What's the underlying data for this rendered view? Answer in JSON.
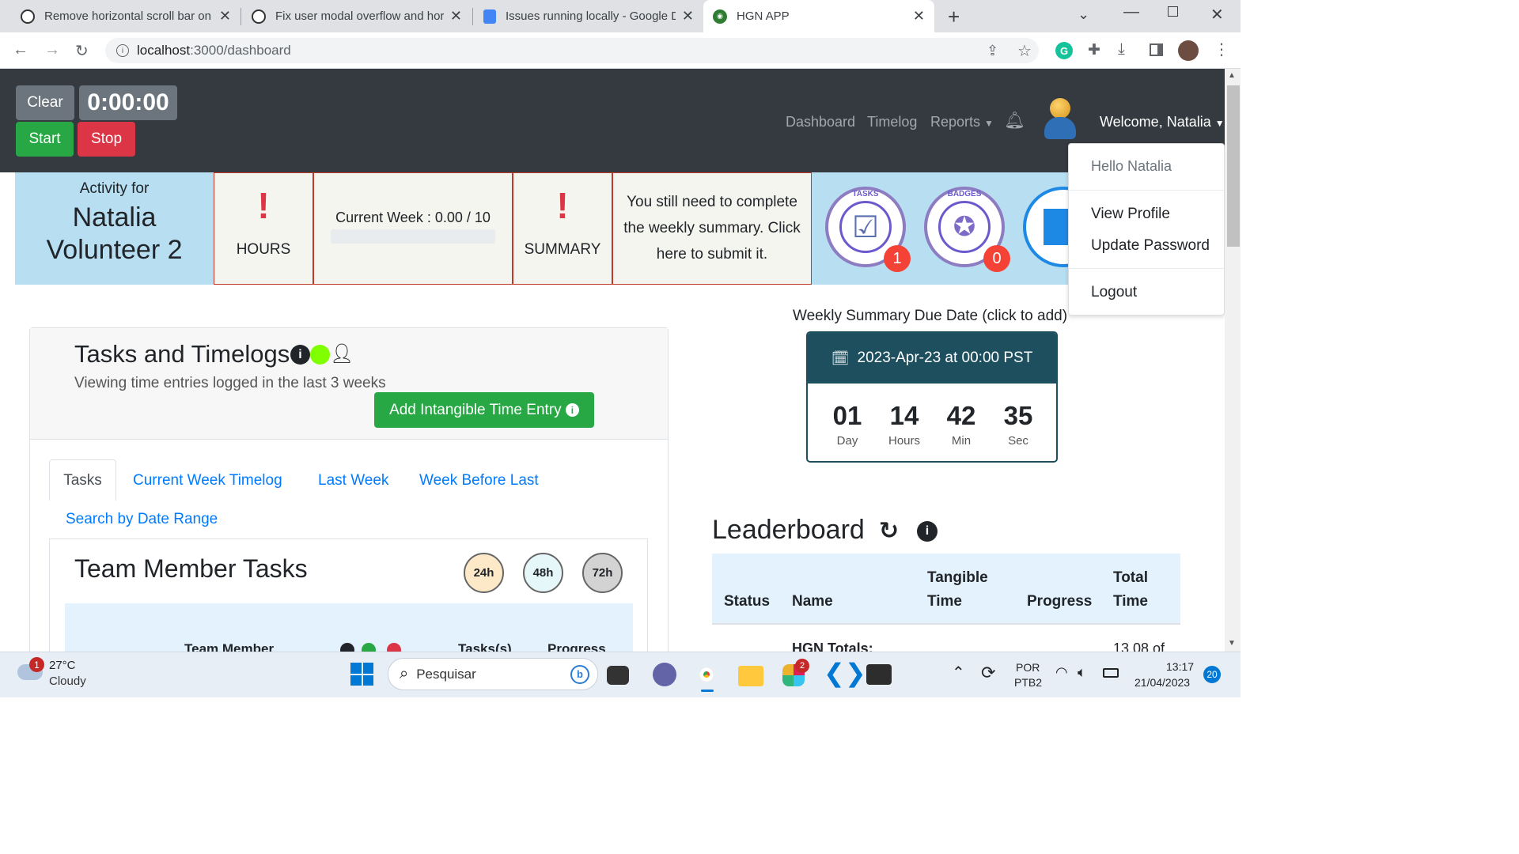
{
  "browser": {
    "tabs": [
      {
        "title": "Remove horizontal scroll bar on c"
      },
      {
        "title": "Fix user modal overflow and hori"
      },
      {
        "title": "Issues running locally - Google D"
      },
      {
        "title": "HGN APP"
      }
    ],
    "new_tab": "+",
    "url_host": "localhost",
    "url_path": ":3000/dashboard"
  },
  "timer": {
    "clear": "Clear",
    "time": "0:00:00",
    "start": "Start",
    "stop": "Stop"
  },
  "nav": {
    "dashboard": "Dashboard",
    "timelog": "Timelog",
    "reports": "Reports",
    "welcome": "Welcome, Natalia"
  },
  "dropdown": {
    "hello": "Hello Natalia",
    "view_profile": "View Profile",
    "update_password": "Update Password",
    "logout": "Logout"
  },
  "activity": {
    "label": "Activity for",
    "name": "Natalia Volunteer 2",
    "hours_label": "HOURS",
    "current_week": "Current Week : 0.00 / 10",
    "week_progress": 0,
    "summary_label": "SUMMARY",
    "summary_msg": "You still need to complete the weekly summary. Click here to submit it.",
    "badge_tasks_count": "1",
    "badge_earned_count": "0",
    "badge_tasks_text": "TASKS",
    "badge_earned_text": "BADGES"
  },
  "tasks_card": {
    "title": "Tasks and Timelogs",
    "subtitle": "Viewing time entries logged in the last 3 weeks",
    "add_button": "Add Intangible Time Entry",
    "tabs": [
      "Tasks",
      "Current Week Timelog",
      "Last Week",
      "Week Before Last"
    ],
    "search_range": "Search by Date Range",
    "team_title": "Team Member Tasks",
    "filters": [
      "24h",
      "48h",
      "72h"
    ],
    "table_headers": [
      "Team Member",
      "Tasks(s)",
      "Progress"
    ]
  },
  "summary_due": {
    "label": "Weekly Summary Due Date (click to add)",
    "date": "2023-Apr-23 at 00:00 PST",
    "countdown": [
      {
        "value": "01",
        "unit": "Day"
      },
      {
        "value": "14",
        "unit": "Hours"
      },
      {
        "value": "42",
        "unit": "Min"
      },
      {
        "value": "35",
        "unit": "Sec"
      }
    ]
  },
  "leaderboard": {
    "title": "Leaderboard",
    "headers": {
      "status": "Status",
      "name": "Name",
      "tangible1": "Tangible",
      "tangible2": "Time",
      "progress": "Progress",
      "total1": "Total",
      "total2": "Time"
    },
    "row_name": "HGN Totals:",
    "row_total": "13.08 of"
  },
  "taskbar": {
    "weather_temp": "27°C",
    "weather_desc": "Cloudy",
    "weather_badge": "1",
    "search_placeholder": "Pesquisar",
    "lang1": "POR",
    "lang2": "PTB2",
    "time": "13:17",
    "date": "21/04/2023",
    "notif": "20",
    "slack_badge": "2"
  }
}
